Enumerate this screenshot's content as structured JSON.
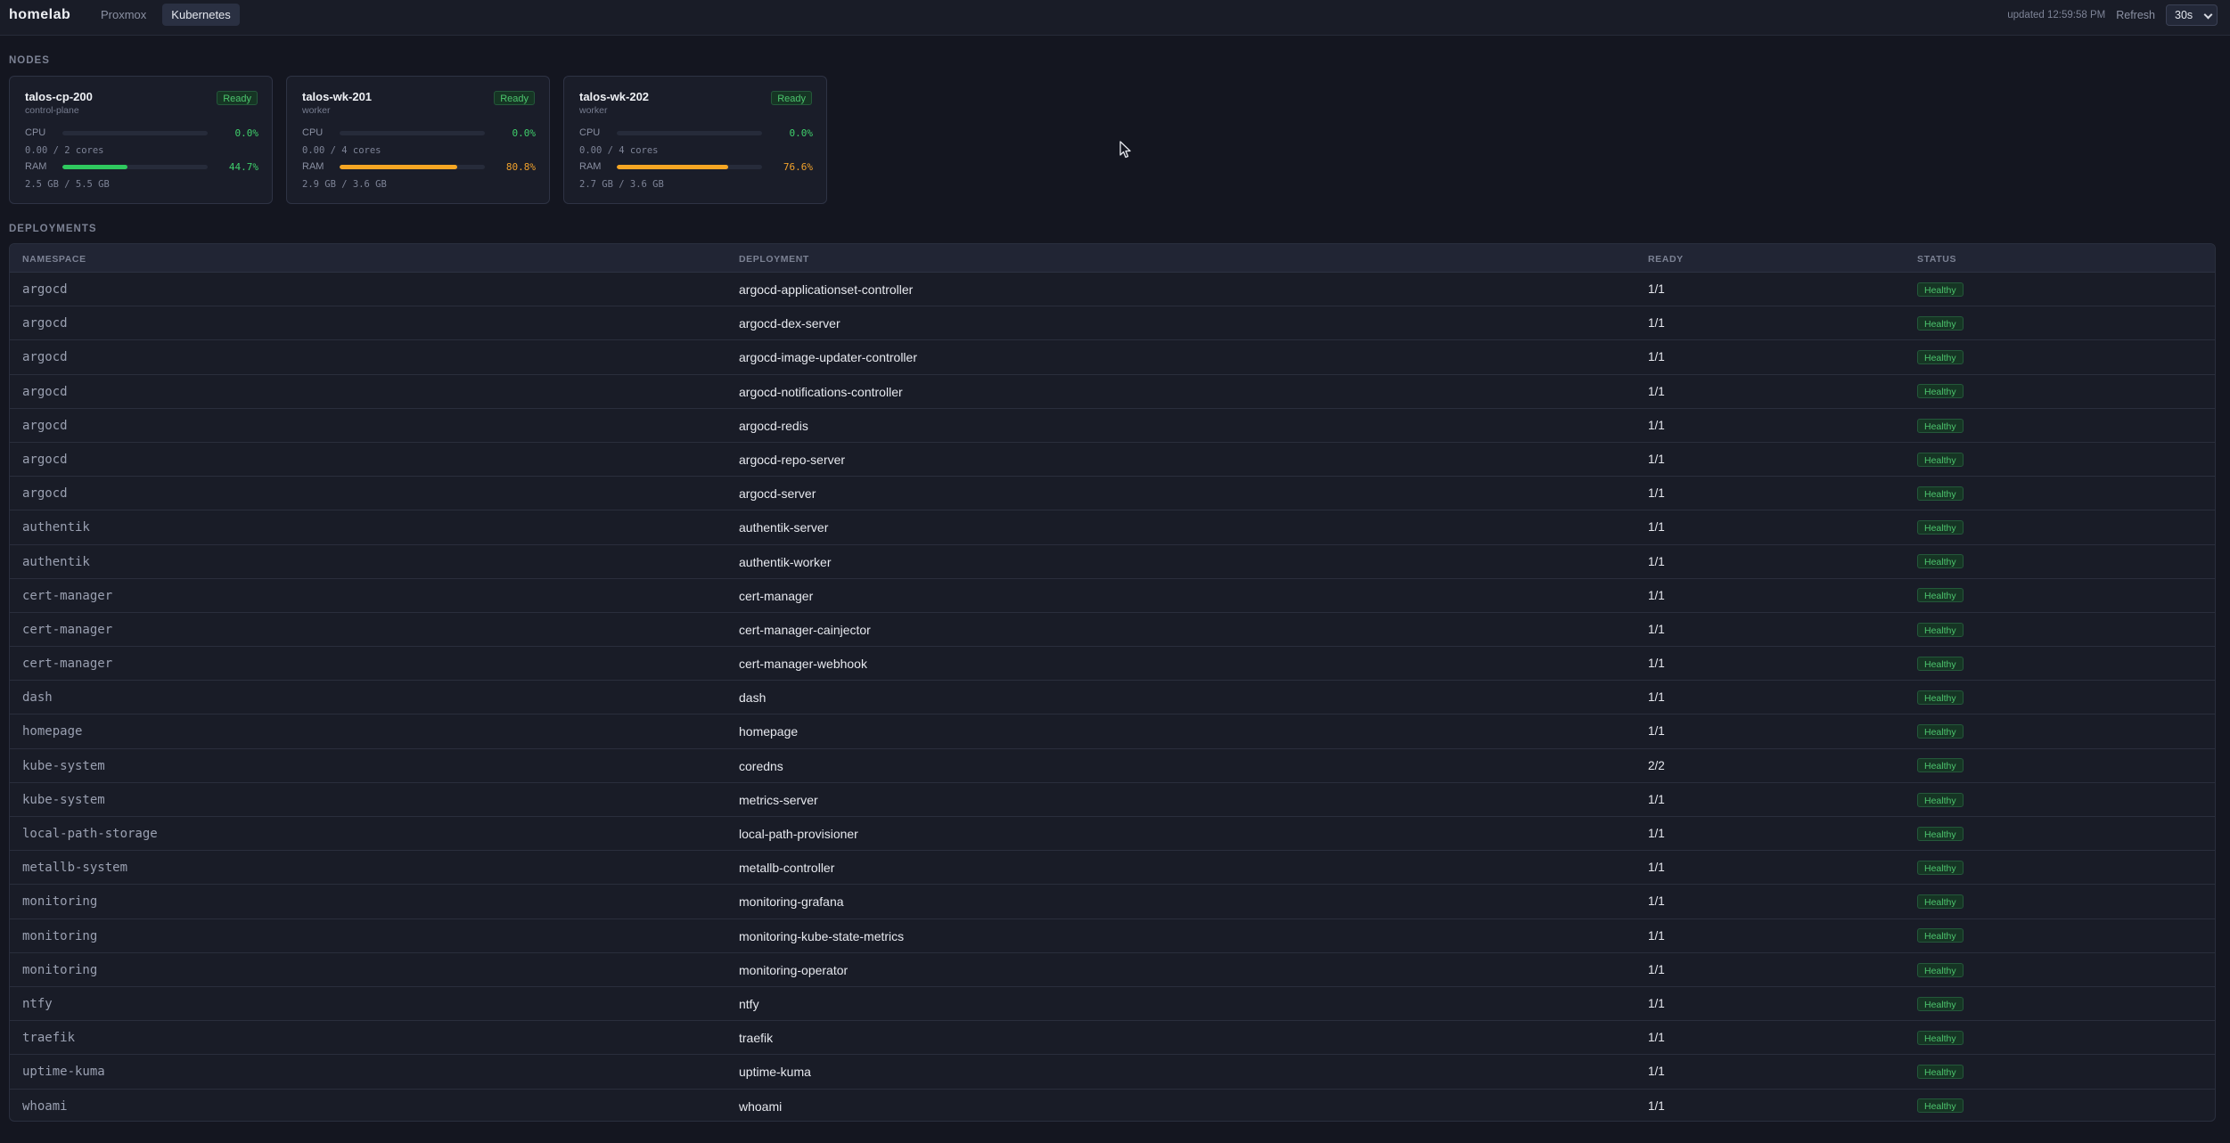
{
  "brand": "homelab",
  "tabs": [
    {
      "label": "Proxmox",
      "active": false
    },
    {
      "label": "Kubernetes",
      "active": true
    }
  ],
  "header": {
    "updated": "updated 12:59:58 PM",
    "refresh_label": "Refresh",
    "refresh_value": "30s"
  },
  "sections": {
    "nodes": "NODES",
    "deployments": "DEPLOYMENTS"
  },
  "nodes": [
    {
      "name": "talos-cp-200",
      "role": "control-plane",
      "status": "Ready",
      "cpu_label": "CPU",
      "cpu_pct": 0.0,
      "cpu_pct_text": "0.0%",
      "cpu_sub": "0.00 / 2 cores",
      "ram_label": "RAM",
      "ram_pct": 44.7,
      "ram_pct_text": "44.7%",
      "ram_sub": "2.5 GB / 5.5 GB",
      "ram_color": "green"
    },
    {
      "name": "talos-wk-201",
      "role": "worker",
      "status": "Ready",
      "cpu_label": "CPU",
      "cpu_pct": 0.0,
      "cpu_pct_text": "0.0%",
      "cpu_sub": "0.00 / 4 cores",
      "ram_label": "RAM",
      "ram_pct": 80.8,
      "ram_pct_text": "80.8%",
      "ram_sub": "2.9 GB / 3.6 GB",
      "ram_color": "orange"
    },
    {
      "name": "talos-wk-202",
      "role": "worker",
      "status": "Ready",
      "cpu_label": "CPU",
      "cpu_pct": 0.0,
      "cpu_pct_text": "0.0%",
      "cpu_sub": "0.00 / 4 cores",
      "ram_label": "RAM",
      "ram_pct": 76.6,
      "ram_pct_text": "76.6%",
      "ram_sub": "2.7 GB / 3.6 GB",
      "ram_color": "orange"
    }
  ],
  "deployments": {
    "columns": [
      "NAMESPACE",
      "DEPLOYMENT",
      "READY",
      "STATUS"
    ],
    "rows": [
      {
        "namespace": "argocd",
        "deployment": "argocd-applicationset-controller",
        "ready": "1/1",
        "status": "Healthy"
      },
      {
        "namespace": "argocd",
        "deployment": "argocd-dex-server",
        "ready": "1/1",
        "status": "Healthy"
      },
      {
        "namespace": "argocd",
        "deployment": "argocd-image-updater-controller",
        "ready": "1/1",
        "status": "Healthy"
      },
      {
        "namespace": "argocd",
        "deployment": "argocd-notifications-controller",
        "ready": "1/1",
        "status": "Healthy"
      },
      {
        "namespace": "argocd",
        "deployment": "argocd-redis",
        "ready": "1/1",
        "status": "Healthy"
      },
      {
        "namespace": "argocd",
        "deployment": "argocd-repo-server",
        "ready": "1/1",
        "status": "Healthy"
      },
      {
        "namespace": "argocd",
        "deployment": "argocd-server",
        "ready": "1/1",
        "status": "Healthy"
      },
      {
        "namespace": "authentik",
        "deployment": "authentik-server",
        "ready": "1/1",
        "status": "Healthy"
      },
      {
        "namespace": "authentik",
        "deployment": "authentik-worker",
        "ready": "1/1",
        "status": "Healthy"
      },
      {
        "namespace": "cert-manager",
        "deployment": "cert-manager",
        "ready": "1/1",
        "status": "Healthy"
      },
      {
        "namespace": "cert-manager",
        "deployment": "cert-manager-cainjector",
        "ready": "1/1",
        "status": "Healthy"
      },
      {
        "namespace": "cert-manager",
        "deployment": "cert-manager-webhook",
        "ready": "1/1",
        "status": "Healthy"
      },
      {
        "namespace": "dash",
        "deployment": "dash",
        "ready": "1/1",
        "status": "Healthy"
      },
      {
        "namespace": "homepage",
        "deployment": "homepage",
        "ready": "1/1",
        "status": "Healthy"
      },
      {
        "namespace": "kube-system",
        "deployment": "coredns",
        "ready": "2/2",
        "status": "Healthy"
      },
      {
        "namespace": "kube-system",
        "deployment": "metrics-server",
        "ready": "1/1",
        "status": "Healthy"
      },
      {
        "namespace": "local-path-storage",
        "deployment": "local-path-provisioner",
        "ready": "1/1",
        "status": "Healthy"
      },
      {
        "namespace": "metallb-system",
        "deployment": "metallb-controller",
        "ready": "1/1",
        "status": "Healthy"
      },
      {
        "namespace": "monitoring",
        "deployment": "monitoring-grafana",
        "ready": "1/1",
        "status": "Healthy"
      },
      {
        "namespace": "monitoring",
        "deployment": "monitoring-kube-state-metrics",
        "ready": "1/1",
        "status": "Healthy"
      },
      {
        "namespace": "monitoring",
        "deployment": "monitoring-operator",
        "ready": "1/1",
        "status": "Healthy"
      },
      {
        "namespace": "ntfy",
        "deployment": "ntfy",
        "ready": "1/1",
        "status": "Healthy"
      },
      {
        "namespace": "traefik",
        "deployment": "traefik",
        "ready": "1/1",
        "status": "Healthy"
      },
      {
        "namespace": "uptime-kuma",
        "deployment": "uptime-kuma",
        "ready": "1/1",
        "status": "Healthy"
      },
      {
        "namespace": "whoami",
        "deployment": "whoami",
        "ready": "1/1",
        "status": "Healthy"
      }
    ]
  }
}
